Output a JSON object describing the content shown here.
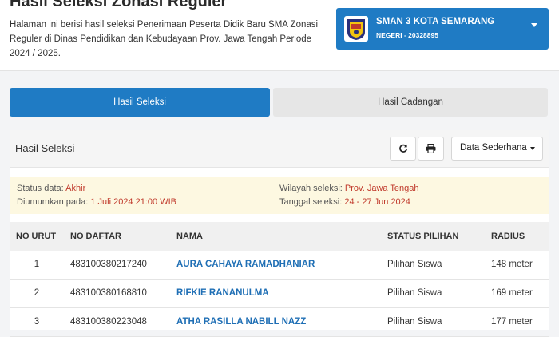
{
  "header": {
    "title": "Hasil Seleksi Zonasi Reguler",
    "description": "Halaman ini berisi hasil seleksi Penerimaan Peserta Didik Baru SMA Zonasi Reguler di Dinas Pendidikan dan Kebudayaan Prov. Jawa Tengah Periode 2024 / 2025."
  },
  "school": {
    "name": "SMAN 3 KOTA SEMARANG",
    "subtitle": "NEGERI - 20328895",
    "logo_icon": "school-crest-icon",
    "color": "#1f7bc4"
  },
  "tabs": [
    {
      "label": "Hasil Seleksi",
      "active": true
    },
    {
      "label": "Hasil Cadangan",
      "active": false
    }
  ],
  "panel": {
    "title": "Hasil Seleksi",
    "refresh_icon": "refresh-icon",
    "print_icon": "print-icon",
    "view_select": "Data Sederhana"
  },
  "info": {
    "status_label": "Status data:",
    "status_value": "Akhir",
    "announced_label": "Diumumkan pada:",
    "announced_value": "1 Juli 2024 21:00 WIB",
    "region_label": "Wilayah seleksi:",
    "region_value": "Prov. Jawa Tengah",
    "date_label": "Tanggal seleksi:",
    "date_value": "24 - 27 Jun 2024",
    "value_color": "#c0392b"
  },
  "table": {
    "headers": [
      "NO URUT",
      "NO DAFTAR",
      "NAMA",
      "STATUS PILIHAN",
      "RADIUS"
    ],
    "rows": [
      {
        "no": "1",
        "daftar": "483100380217240",
        "nama": "AURA CAHAYA RAMADHANIAR",
        "status": "Pilihan Siswa",
        "radius": "148 meter"
      },
      {
        "no": "2",
        "daftar": "483100380168810",
        "nama": "RIFKIE RANANULMA",
        "status": "Pilihan Siswa",
        "radius": "169 meter"
      },
      {
        "no": "3",
        "daftar": "483100380223048",
        "nama": "ATHA RASILLA NABILL NAZZ",
        "status": "Pilihan Siswa",
        "radius": "177 meter"
      }
    ]
  }
}
